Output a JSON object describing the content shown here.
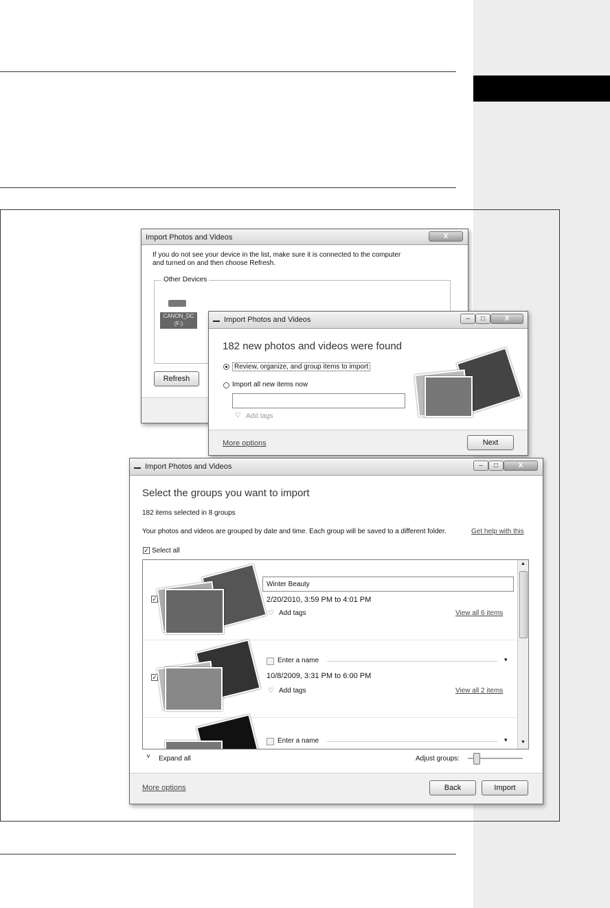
{
  "window1": {
    "title": "Import Photos and Videos",
    "message": "If you do not see your device in the list, make sure it is connected to the computer and turned on and then choose Refresh.",
    "group_label": "Other Devices",
    "device_label": "CANON_DC (F:)",
    "refresh_button": "Refresh",
    "close_glyph": "X"
  },
  "window2": {
    "title": "Import Photos and Videos",
    "heading": "182 new photos and videos were found",
    "option_review": "Review, organize, and group items to import",
    "option_import_all": "Import all new items now",
    "add_tags": "Add tags",
    "more_options": "More options",
    "next_button": "Next"
  },
  "window3": {
    "title": "Import Photos and Videos",
    "heading": "Select the groups you want to import",
    "summary": "182 items selected in 8 groups",
    "description": "Your photos and videos are grouped by date and time. Each group will be saved to a different folder.",
    "help_link": "Get help with this",
    "select_all": "Select all",
    "groups": [
      {
        "name": "Winter Beauty",
        "date": "2/20/2010, 3:59 PM to 4:01 PM",
        "add_tags": "Add tags",
        "view_link": "View all 6 items"
      },
      {
        "name_placeholder": "Enter a name",
        "date": "10/8/2009, 3:31 PM to 6:00 PM",
        "add_tags": "Add tags",
        "view_link": "View all 2 items"
      },
      {
        "name_placeholder": "Enter a name"
      }
    ],
    "expand_all": "Expand all",
    "adjust_groups": "Adjust groups:",
    "more_options": "More options",
    "back_button": "Back",
    "import_button": "Import"
  },
  "icons": {
    "close": "X",
    "minimize": "–",
    "maximize": "□",
    "check": "✓",
    "tag": "♡",
    "expand": "˅",
    "dropdown": "▾",
    "scroll_up": "▲",
    "scroll_down": "▼"
  }
}
